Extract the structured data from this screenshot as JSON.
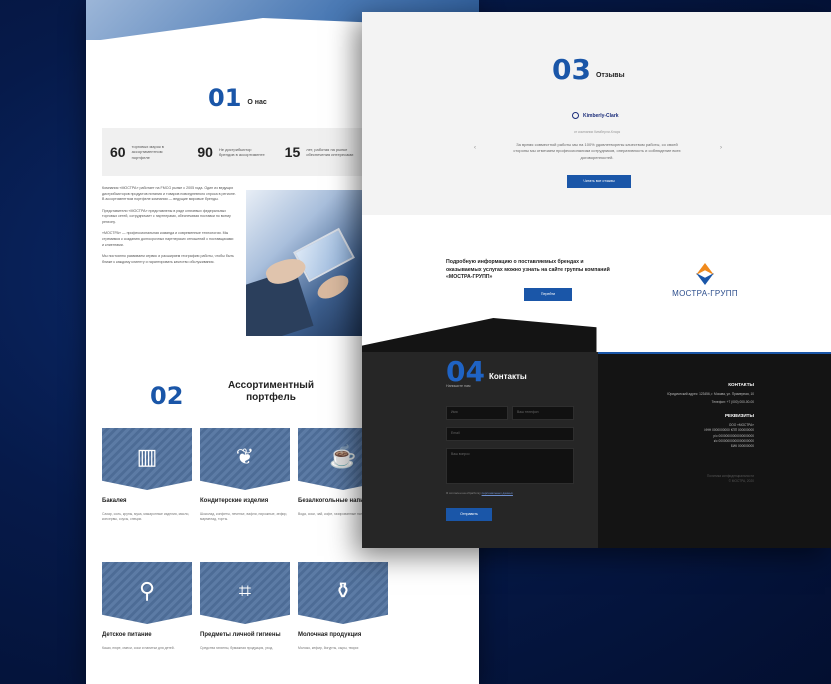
{
  "colors": {
    "accent": "#1a56a8",
    "logo_orange": "#f08a1c",
    "dark_bg": "#141414"
  },
  "about": {
    "number": "01",
    "label": "О нас",
    "stats": [
      {
        "value": "60",
        "text": "торговых марок в ассортиментном портфеле"
      },
      {
        "value": "90",
        "text": "Не дистрибьютор брендов в ассортименте"
      },
      {
        "value": "15",
        "text": "лет, работая на рынке обеспечения интересами"
      }
    ],
    "paragraphs": [
      "Компания «МОСТРА» работает на FMCG рынке с 2005 года. Один из ведущих дистрибьюторов продуктов питания и товаров повседневного спроса в регионе. В ассортиментном портфеле компании — ведущие мировые бренды.",
      "Представители «МОСТРА» представлены в ряде ключевых федеральных торговых сетей, сотрудничает с партнерами, обеспечивая поставки по всему региону.",
      "«МОСТРА» — профессиональная команда и современные технологии. Мы стремимся к созданию долгосрочных партнерских отношений с поставщиками и клиентами.",
      "Мы постоянно развиваем сервис и расширяем географию работы, чтобы быть ближе к каждому клиенту и гарантировать качество обслуживания."
    ]
  },
  "portfolio": {
    "number": "02",
    "label": "Ассортиментный портфель",
    "cards": [
      {
        "title": "Бакалея",
        "icon": "grocery-icon",
        "glyph": "▥",
        "desc": "Сахар, соль, крупы, мука, макаронные изделия, масло, консервы, соусы, специи."
      },
      {
        "title": "Кондитерские изделия",
        "icon": "candy-icon",
        "glyph": "❦",
        "desc": "Шоколад, конфеты, печенье, вафли, пирожные, зефир, мармелад, торты."
      },
      {
        "title": "Безалкогольные напитки",
        "icon": "cup-icon",
        "glyph": "☕",
        "desc": "Вода, соки, чай, кофе, газированные напитки, морсы."
      },
      {
        "title": "Детское питание",
        "icon": "baby-food-icon",
        "glyph": "⚲",
        "desc": "Каши, пюре, смеси, соки и напитки для детей."
      },
      {
        "title": "Предметы личной гигиены",
        "icon": "hygiene-icon",
        "glyph": "⌗",
        "desc": "Средства гигиены, бумажная продукция, уход."
      },
      {
        "title": "Молочная продукция",
        "icon": "milk-icon",
        "glyph": "⚱",
        "desc": "Молоко, кефир, йогурты, сыры, творог."
      }
    ]
  },
  "reviews": {
    "number": "03",
    "label": "Отзывы",
    "brand": "Kimberly-Clark",
    "meta": "от компании Кимберли-Кларк",
    "text": "За время совместной работы мы на 100% удовлетворены качеством работы, со своей стороны мы отмечаем профессионализм сотрудников, оперативность и соблюдение всех договоренностей.",
    "prev": "‹",
    "next": "›",
    "button": "Читать все отзывы"
  },
  "info": {
    "text": "Подробную информацию о поставляемых брендах и оказываемых услугах можно узнать на сайте группы компаний «МОСТРА-ГРУПП»",
    "button": "Перейти",
    "logo_text": "МОСТРА-ГРУПП"
  },
  "contacts": {
    "number": "04",
    "label": "Контакты",
    "subtitle": "Напишите нам",
    "name_placeholder": "Имя",
    "phone_placeholder": "Ваш телефон",
    "email_placeholder": "Email",
    "message_placeholder": "Ваш вопрос",
    "consent_prefix": "Я согласен на обработку ",
    "consent_link": "персональных данных",
    "send": "Отправить",
    "right_heading": "КОНТАКТЫ",
    "address": "Юридический адрес: 123456, г. Москва, ул. Примерная, 10",
    "phone": "Телефон: +7 (000) 000-00-00",
    "req_heading": "РЕКВИЗИТЫ",
    "req_lines": [
      "ООО «МОСТРА»",
      "ИНН 0000000000 КПП 000000000",
      "р/с 00000000000000000000",
      "к/с 00000000000000000000",
      "БИК 000000000"
    ],
    "footer_1": "Политика конфиденциальности",
    "footer_2": "© МОСТРА, 2020"
  }
}
